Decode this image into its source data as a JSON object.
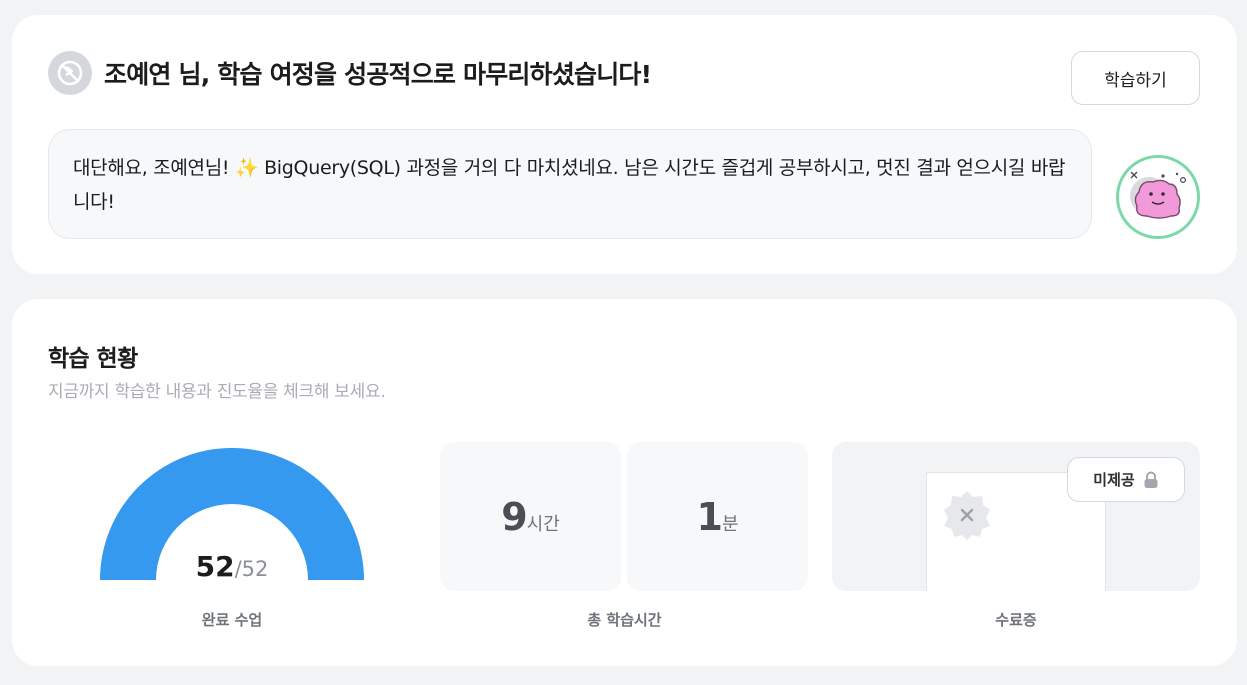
{
  "header": {
    "title": "조예연 님, 학습 여정을 성공적으로 마무리하셨습니다!",
    "learn_button": "학습하기",
    "message": "대단해요, 조예연님! ✨ BigQuery(SQL) 과정을 거의 다 마치셨네요. 남은 시간도 즐겁게 공부하시고, 멋진 결과 얻으시길 바랍니다!"
  },
  "status": {
    "title": "학습 현황",
    "subtitle": "지금까지 학습한 내용과 진도율을 체크해 보세요.",
    "completed": {
      "done": "52",
      "total": "/52",
      "label": "완료 수업",
      "progress": 1.0
    },
    "study_time": {
      "hours": "9",
      "hours_unit": "시간",
      "minutes": "1",
      "minutes_unit": "분",
      "label": "총 학습시간"
    },
    "certificate": {
      "badge": "미제공",
      "label": "수료증",
      "lock_icon": "lock-icon"
    }
  },
  "colors": {
    "gauge": "#3499ef",
    "avatar_ring": "#7bd9a7"
  }
}
